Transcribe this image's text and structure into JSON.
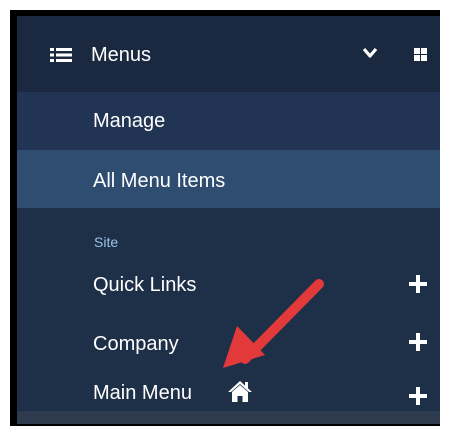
{
  "header": {
    "title": "Menus",
    "menu_icon": "list-icon",
    "toggle_icon": "chevron-down-icon",
    "dashboard_icon": "grid-icon"
  },
  "nav": {
    "manage_label": "Manage",
    "all_items_label": "All Menu Items"
  },
  "section": {
    "label": "Site",
    "items": [
      {
        "label": "Quick Links",
        "action_icon": "plus-icon"
      },
      {
        "label": "Company",
        "action_icon": "plus-icon"
      },
      {
        "label": "Main Menu",
        "badge_icon": "home-icon",
        "action_icon": "plus-icon"
      }
    ]
  },
  "colors": {
    "sidebar_bg": "#1e2f48",
    "active_bg": "#2e4d70",
    "section_label": "#9ec0e6",
    "annotation_arrow": "#e23a3a"
  }
}
